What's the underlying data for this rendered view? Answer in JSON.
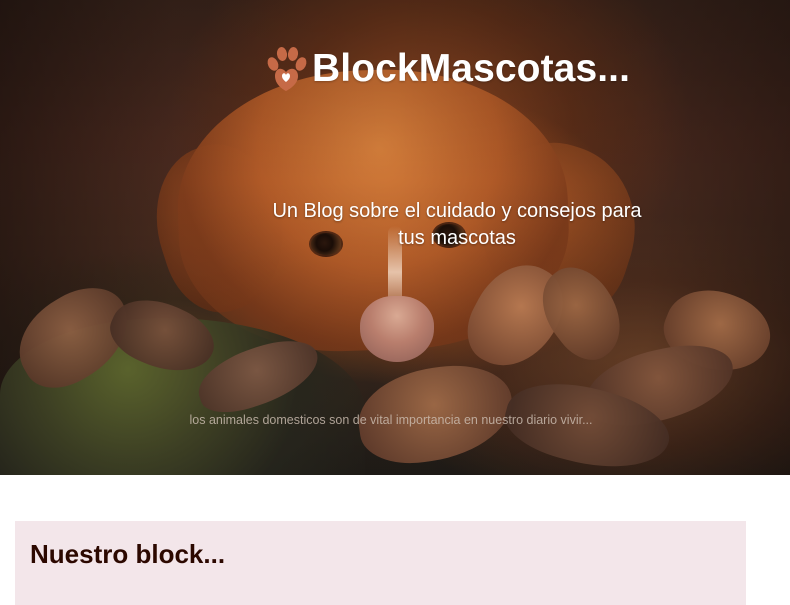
{
  "hero": {
    "site_title": "BlockMascotas...",
    "subtitle": "Un Blog sobre el cuidado y consejos para tus mascotas",
    "tagline": "los animales domesticos son de vital importancia en nuestro diario vivir..."
  },
  "logo": {
    "icon": "paw-heart-icon",
    "icon_color": "#c66a47"
  },
  "section": {
    "title": "Nuestro block..."
  },
  "colors": {
    "hero_text": "#ffffff",
    "section_background": "#f3e6ea",
    "section_title": "#2c0800"
  }
}
